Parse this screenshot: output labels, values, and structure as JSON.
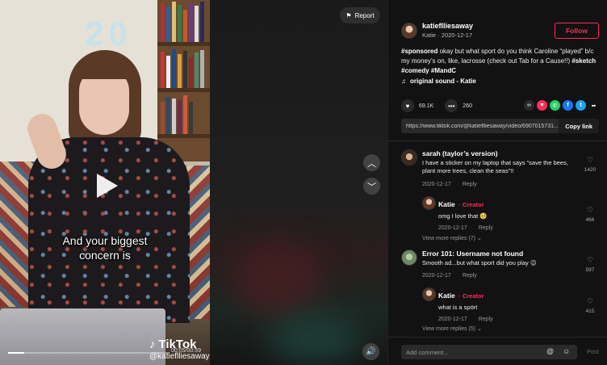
{
  "video": {
    "caption_line1": "And your biggest",
    "caption_line2": "concern is",
    "watermark_brand": "TikTok",
    "watermark_handle": "@katieflliesaway",
    "time": "00:05/00:59",
    "progress": 0.1,
    "report_label": "Report"
  },
  "author": {
    "username": "katieflliesaway",
    "display_name": "Katie",
    "date": "2020-12-17",
    "follow_label": "Follow"
  },
  "description": {
    "tag1": "#sponsored",
    "text": " okay but what sport do you think Caroline “played” b/c my money’s on, like, lacrosse (check out Tab for a Cause!!) ",
    "tag2": "#sketch",
    "tag3": "#comedy",
    "tag4": "#MandC"
  },
  "music": {
    "title": "original sound - Katie"
  },
  "stats": {
    "likes": "69.1K",
    "comments": "260"
  },
  "link": {
    "url": "https://www.tiktok.com/@katieflliesaway/video/6907015731...",
    "copy_label": "Copy link"
  },
  "comments": [
    {
      "name": "sarah (taylor’s version)",
      "text": "I have a sticker on my laptop that says “save the bees, plant more trees, clean the seas”!!",
      "date": "2020-12-17",
      "reply": "Reply",
      "likes": "1420"
    },
    {
      "name": "Katie",
      "creator": "· Creator",
      "text": "omg I love that 🥺",
      "date": "2020-12-17",
      "reply": "Reply",
      "likes": "466"
    },
    {
      "more": "View more replies (7)"
    },
    {
      "name": "Error 101: Username not found",
      "text": "Smooth ad...but what sport did you play 😉",
      "date": "2020-12-17",
      "reply": "Reply",
      "likes": "597"
    },
    {
      "name": "Katie",
      "creator": "· Creator",
      "text": "what is a spört",
      "date": "2020-12-17",
      "reply": "Reply",
      "likes": "415"
    },
    {
      "more": "View more replies (5)"
    }
  ],
  "comment_bar": {
    "placeholder": "Add comment...",
    "post_label": "Post"
  },
  "colors": {
    "accent": "#fe2c55",
    "background": "#121212"
  }
}
